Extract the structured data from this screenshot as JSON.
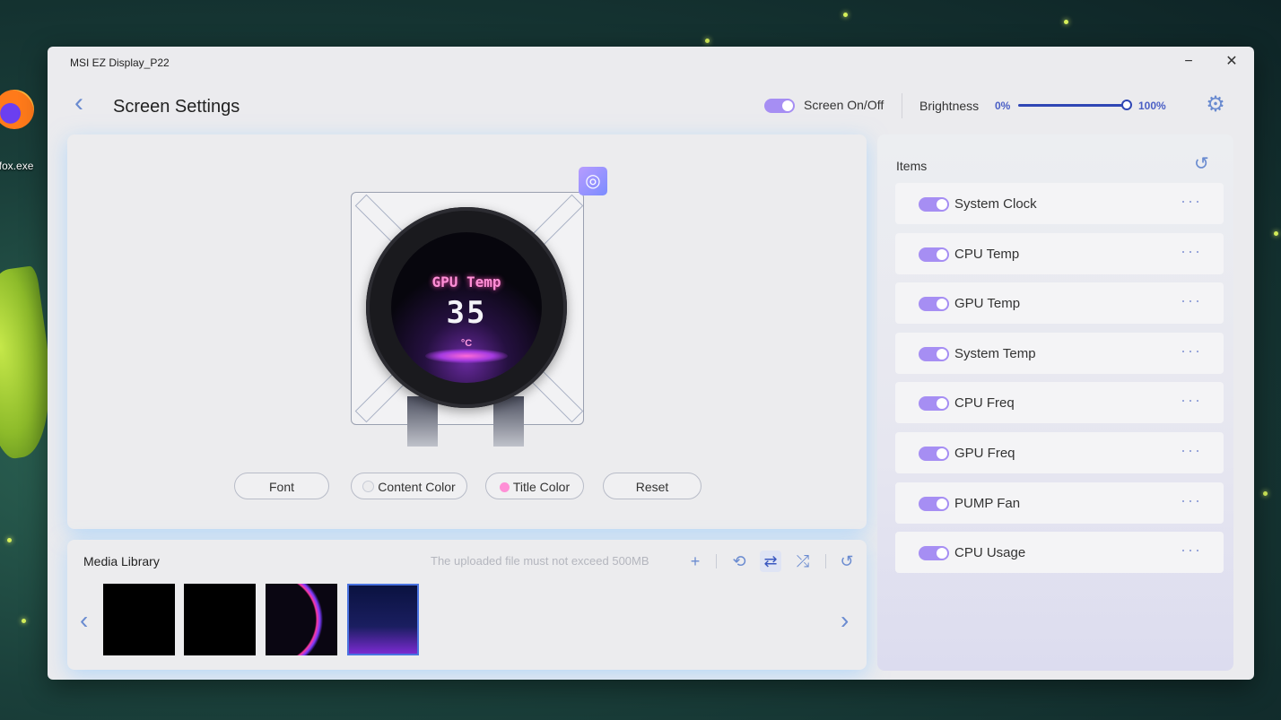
{
  "desktop": {
    "icon_label": "efox.exe"
  },
  "window": {
    "title": "MSI EZ Display_P22",
    "minimize": "−",
    "close": "✕"
  },
  "header": {
    "back_icon": "‹",
    "page_title": "Screen Settings",
    "screen_toggle_label": "Screen On/Off",
    "screen_on": true,
    "brightness_label": "Brightness",
    "brightness_min": "0%",
    "brightness_max": "100%",
    "brightness_value": 1.0,
    "settings_icon": "⚙"
  },
  "preview": {
    "lcd_title": "GPU Temp",
    "lcd_value": "35",
    "lcd_unit": "°C",
    "edit_icon": "◎",
    "buttons": {
      "font": "Font",
      "content_color": "Content Color",
      "title_color": "Title Color",
      "reset": "Reset"
    },
    "content_color_hex": "#ececee",
    "title_color_hex": "#ff8fd6"
  },
  "media": {
    "title": "Media Library",
    "note": "The uploaded file must not exceed 500MB",
    "add_icon": "+",
    "repeat_icon": "⟲",
    "loop_icon": "⇄",
    "shuffle_icon": "⤮",
    "reset_icon": "↺",
    "prev_icon": "‹",
    "next_icon": "›"
  },
  "items": {
    "title": "Items",
    "reset_icon": "↺",
    "more_icon": "···",
    "list": [
      {
        "label": "System Clock",
        "enabled": true
      },
      {
        "label": "CPU Temp",
        "enabled": true
      },
      {
        "label": "GPU Temp",
        "enabled": true
      },
      {
        "label": "System Temp",
        "enabled": true
      },
      {
        "label": "CPU Freq",
        "enabled": true
      },
      {
        "label": "GPU Freq",
        "enabled": true
      },
      {
        "label": "PUMP Fan",
        "enabled": true
      },
      {
        "label": "CPU Usage",
        "enabled": true
      }
    ]
  },
  "colors": {
    "accent": "#a68ef3",
    "link": "#6a8bd0",
    "slider": "#2f46b5"
  }
}
